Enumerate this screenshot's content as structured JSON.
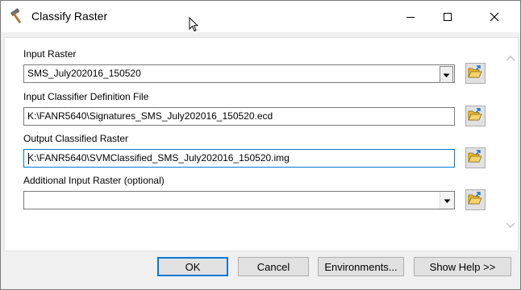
{
  "window": {
    "title": "Classify Raster",
    "icon": "hammer-icon",
    "controls": [
      "minimize-icon",
      "maximize-icon",
      "close-icon"
    ]
  },
  "fields": [
    {
      "label": "Input Raster",
      "value": "SMS_July202016_150520",
      "type": "combo",
      "browse_icon": "open-folder-icon"
    },
    {
      "label": "Input Classifier Definition File",
      "value": "K:\\FANR5640\\Signatures_SMS_July202016_150520.ecd",
      "type": "text",
      "browse_icon": "open-folder-icon"
    },
    {
      "label": "Output Classified Raster",
      "value": "K:\\FANR5640\\SVMClassified_SMS_July202016_150520.img",
      "type": "text",
      "focused": true,
      "browse_icon": "open-folder-icon"
    },
    {
      "label": "Additional Input Raster (optional)",
      "value": "",
      "type": "combo",
      "browse_icon": "open-folder-icon"
    }
  ],
  "buttons": {
    "ok": "OK",
    "cancel": "Cancel",
    "environments": "Environments...",
    "show_help": "Show Help >>"
  },
  "colors": {
    "focus_border": "#0078d7",
    "dialog_bg": "#f0f0f0",
    "folder_yellow": "#e8b62f"
  }
}
